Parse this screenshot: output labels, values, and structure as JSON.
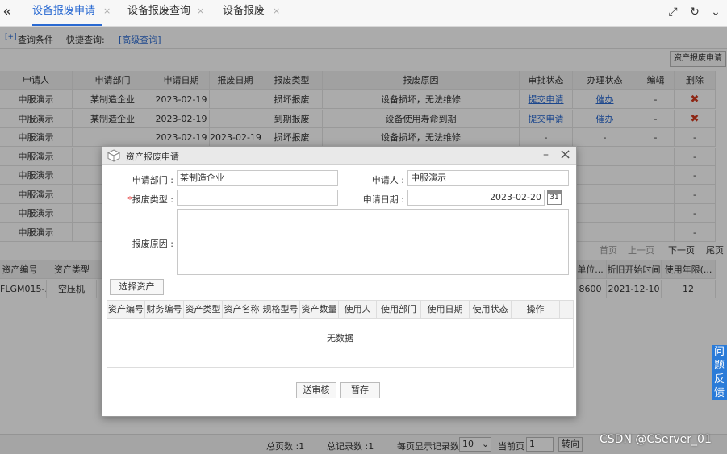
{
  "tabs": [
    {
      "label": "设备报废申请",
      "active": true
    },
    {
      "label": "设备报废查询",
      "active": false
    },
    {
      "label": "设备报废",
      "active": false
    }
  ],
  "query": {
    "toggle": "[+]",
    "conditions": "查询条件",
    "quick": "快捷查询:",
    "advanced": "[高级查询]"
  },
  "apply_button": "资产报废申请",
  "main_table": {
    "headers": [
      "申请人",
      "申请部门",
      "申请日期",
      "报废日期",
      "报废类型",
      "报废原因",
      "审批状态",
      "办理状态",
      "编辑",
      "删除"
    ],
    "rows": [
      [
        "中服演示",
        "某制造企业",
        "2023-02-19",
        "",
        "损坏报废",
        "设备损坏，无法维修",
        "提交申请",
        "催办",
        "-",
        "✖"
      ],
      [
        "中服演示",
        "某制造企业",
        "2023-02-19",
        "",
        "到期报废",
        "设备使用寿命到期",
        "提交申请",
        "催办",
        "-",
        "✖"
      ],
      [
        "中服演示",
        "",
        "2023-02-19",
        "2023-02-19",
        "损坏报废",
        "设备损坏，无法维修",
        "-",
        "-",
        "-",
        "-"
      ],
      [
        "中服演示",
        "",
        "",
        "",
        "",
        "",
        "",
        "",
        "",
        "-"
      ],
      [
        "中服演示",
        "",
        "",
        "",
        "",
        "",
        "",
        "",
        "",
        "-"
      ],
      [
        "中服演示",
        "",
        "",
        "",
        "",
        "",
        "",
        "",
        "",
        "-"
      ],
      [
        "中服演示",
        "",
        "",
        "",
        "",
        "",
        "",
        "",
        "",
        "-"
      ],
      [
        "中服演示",
        "",
        "",
        "",
        "",
        "",
        "",
        "",
        "",
        "-"
      ]
    ]
  },
  "pager_top": {
    "first": "首页",
    "prev": "上一页",
    "next": "下一页",
    "last": "尾页"
  },
  "asset_table": {
    "headers": [
      "资产编号",
      "资产类型",
      "单位...",
      "折旧开始时间",
      "使用年限(..."
    ],
    "row": [
      "FLGM015-...",
      "空压机",
      "8600",
      "2021-12-10",
      "12"
    ]
  },
  "bottom": {
    "total_pages": "总页数 :1",
    "total_records": "总记录数 :1",
    "per_page_label": "每页显示记录数",
    "per_page_value": "10",
    "current_page_label": "当前页",
    "current_page_value": "1",
    "goto": "转向"
  },
  "feedback": "问题反馈",
  "watermark": "CSDN @CServer_01",
  "modal": {
    "title": "资产报废申请",
    "dept_label": "申请部门 :",
    "dept_value": "某制造企业",
    "applicant_label": "申请人 :",
    "applicant_value": "中服演示",
    "type_label": "报废类型 :",
    "type_required": "*",
    "type_value": "",
    "date_label": "申请日期 :",
    "date_value": "2023-02-20",
    "calendar_day": "31",
    "reason_label": "报废原因 :",
    "select_asset": "选择资产",
    "asset_headers": [
      "资产编号",
      "财务编号",
      "资产类型",
      "资产名称",
      "规格型号",
      "资产数量",
      "使用人",
      "使用部门",
      "使用日期",
      "使用状态",
      "操作"
    ],
    "no_data": "无数据",
    "submit": "送审核",
    "save": "暂存"
  }
}
